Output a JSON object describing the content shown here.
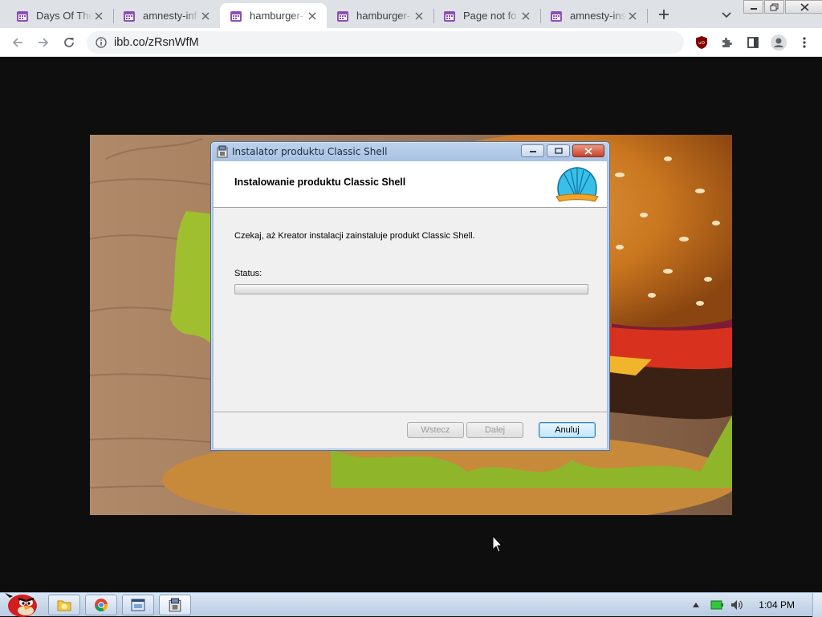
{
  "browser": {
    "tabs": [
      {
        "title": "Days Of The",
        "active": false
      },
      {
        "title": "amnesty-inf",
        "active": false
      },
      {
        "title": "hamburger-",
        "active": true
      },
      {
        "title": "hamburger-",
        "active": false
      },
      {
        "title": "Page not fo",
        "active": false
      },
      {
        "title": "amnesty-ins",
        "active": false
      }
    ],
    "address": "ibb.co/zRsnWfM",
    "accent": "#8e4fb3"
  },
  "installer": {
    "window_title": "Instalator produktu Classic Shell",
    "header_title": "Instalowanie produktu Classic Shell",
    "message": "Czekaj, aż Kreator instalacji zainstaluje produkt Classic Shell.",
    "status_label": "Status:",
    "progress_percent": 0,
    "buttons": {
      "back": "Wstecz",
      "next": "Dalej",
      "cancel": "Anuluj"
    }
  },
  "taskbar": {
    "clock": "1:04 PM",
    "items": [
      "folder-icon",
      "chrome-icon",
      "window-icon",
      "installer-icon"
    ]
  }
}
